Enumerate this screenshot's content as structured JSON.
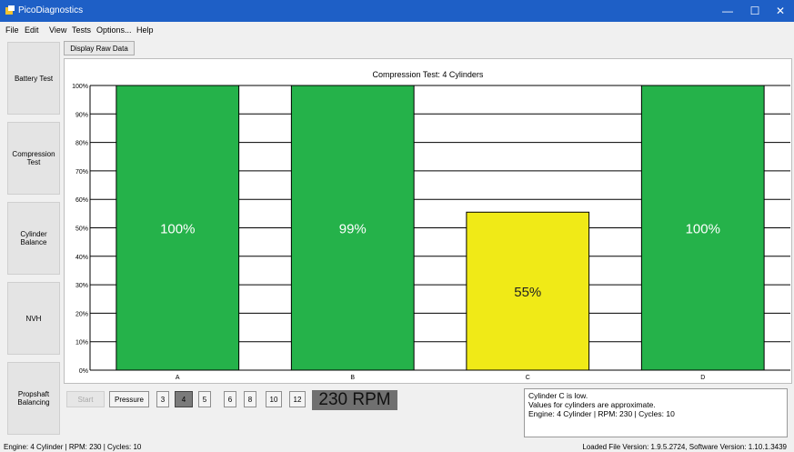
{
  "window": {
    "title": "PicoDiagnostics",
    "minimize": "—",
    "maximize": "☐",
    "close": "✕"
  },
  "menu": [
    "File",
    "Edit",
    "View",
    "Tests",
    "Options...",
    "Help"
  ],
  "sidebar": [
    {
      "label": "Battery Test"
    },
    {
      "label": "Compression\nTest"
    },
    {
      "label": "Cylinder\nBalance"
    },
    {
      "label": "NVH"
    },
    {
      "label": "Propshaft\nBalancing"
    }
  ],
  "toolbar": {
    "raw_label": "Display Raw Data"
  },
  "chart_data": {
    "type": "bar",
    "title": "Compression Test: 4 Cylinders",
    "categories": [
      "A",
      "B",
      "C",
      "D"
    ],
    "values": [
      100,
      99,
      55,
      100
    ],
    "bar_display_height": [
      100,
      100,
      55.5,
      100
    ],
    "labels": [
      "100%",
      "99%",
      "55%",
      "100%"
    ],
    "colors": [
      "#25b24a",
      "#25b24a",
      "#f0ea17",
      "#25b24a"
    ],
    "ylim": [
      0,
      100
    ],
    "yticks": [
      "0%",
      "10%",
      "20%",
      "30%",
      "40%",
      "50%",
      "60%",
      "70%",
      "80%",
      "90%",
      "100%"
    ],
    "grid": true
  },
  "controls": {
    "start": "Start",
    "pressure": "Pressure",
    "cylinders": [
      "3",
      "4",
      "5",
      "6",
      "8",
      "10",
      "12"
    ],
    "selected_cylinder": "4",
    "rpm": "230 RPM"
  },
  "info": {
    "lines": [
      "Cylinder C is low.",
      "Values for cylinders are approximate.",
      "Engine: 4 Cylinder | RPM: 230 | Cycles: 10"
    ]
  },
  "status": {
    "left": "Engine: 4 Cylinder | RPM: 230 | Cycles: 10",
    "right": "Loaded File Version: 1.9.5.2724,   Software Version: 1.10.1.3439"
  }
}
